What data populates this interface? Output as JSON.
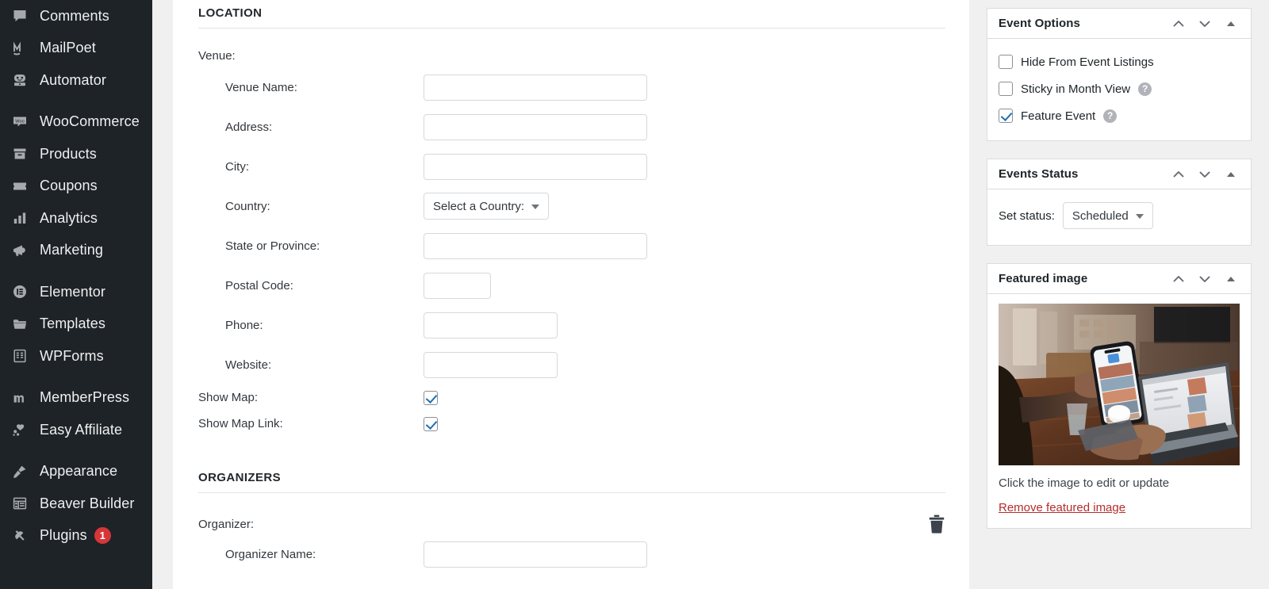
{
  "sidebar": {
    "items": [
      {
        "label": "Comments",
        "icon": "comments-icon"
      },
      {
        "label": "MailPoet",
        "icon": "mailpoet-icon"
      },
      {
        "label": "Automator",
        "icon": "automator-icon"
      },
      {
        "label": "WooCommerce",
        "icon": "woocommerce-icon",
        "gap_before": true
      },
      {
        "label": "Products",
        "icon": "products-icon"
      },
      {
        "label": "Coupons",
        "icon": "coupons-icon"
      },
      {
        "label": "Analytics",
        "icon": "analytics-icon"
      },
      {
        "label": "Marketing",
        "icon": "marketing-icon"
      },
      {
        "label": "Elementor",
        "icon": "elementor-icon",
        "gap_before": true
      },
      {
        "label": "Templates",
        "icon": "templates-icon"
      },
      {
        "label": "WPForms",
        "icon": "wpforms-icon"
      },
      {
        "label": "MemberPress",
        "icon": "memberpress-icon",
        "gap_before": true
      },
      {
        "label": "Easy Affiliate",
        "icon": "easy-affiliate-icon"
      },
      {
        "label": "Appearance",
        "icon": "appearance-icon",
        "gap_before": true
      },
      {
        "label": "Beaver Builder",
        "icon": "beaver-builder-icon"
      },
      {
        "label": "Plugins",
        "icon": "plugins-icon",
        "badge": "1"
      }
    ]
  },
  "main": {
    "location": {
      "section_title": "LOCATION",
      "venue_group_label": "Venue:",
      "fields": [
        {
          "label": "Venue Name:",
          "value": "",
          "width": "wide"
        },
        {
          "label": "Address:",
          "value": "",
          "width": "wide"
        },
        {
          "label": "City:",
          "value": "",
          "width": "wide"
        }
      ],
      "country": {
        "label": "Country:",
        "selected": "Select a Country:"
      },
      "fields2": [
        {
          "label": "State or Province:",
          "value": "",
          "width": "wide"
        },
        {
          "label": "Postal Code:",
          "value": "",
          "width": "small"
        },
        {
          "label": "Phone:",
          "value": "",
          "width": "mid"
        },
        {
          "label": "Website:",
          "value": "",
          "width": "mid"
        }
      ],
      "checkboxes": [
        {
          "label": "Show Map:",
          "checked": true
        },
        {
          "label": "Show Map Link:",
          "checked": true
        }
      ]
    },
    "organizers": {
      "section_title": "ORGANIZERS",
      "organizer_label": "Organizer:",
      "delete_icon": "trash-icon",
      "name_label": "Organizer Name:",
      "name_value": ""
    }
  },
  "rail": {
    "event_options": {
      "title": "Event Options",
      "actions": [
        "chevron-up-icon",
        "chevron-down-icon",
        "toggle-triangle-icon"
      ],
      "options": [
        {
          "label": "Hide From Event Listings",
          "checked": false,
          "help": false
        },
        {
          "label": "Sticky in Month View",
          "checked": false,
          "help": true,
          "help_glyph": "?"
        },
        {
          "label": "Feature Event",
          "checked": true,
          "help": true,
          "help_glyph": "?"
        }
      ]
    },
    "events_status": {
      "title": "Events Status",
      "actions": [
        "chevron-up-icon",
        "chevron-down-icon",
        "toggle-triangle-icon"
      ],
      "set_status_label": "Set status:",
      "status_value": "Scheduled"
    },
    "featured_image": {
      "title": "Featured image",
      "actions": [
        "chevron-up-icon",
        "chevron-down-icon",
        "toggle-triangle-icon"
      ],
      "image_alt": "person holding smartphone beside open laptop on wooden table",
      "caption": "Click the image to edit or update",
      "remove_link": "Remove featured image"
    }
  },
  "colors": {
    "sidebar_bg": "#1d2327",
    "rail_bg": "#f0f0f1",
    "accent_blue": "#2271b1",
    "badge_red": "#d63638",
    "link_red": "#b32d2e"
  }
}
